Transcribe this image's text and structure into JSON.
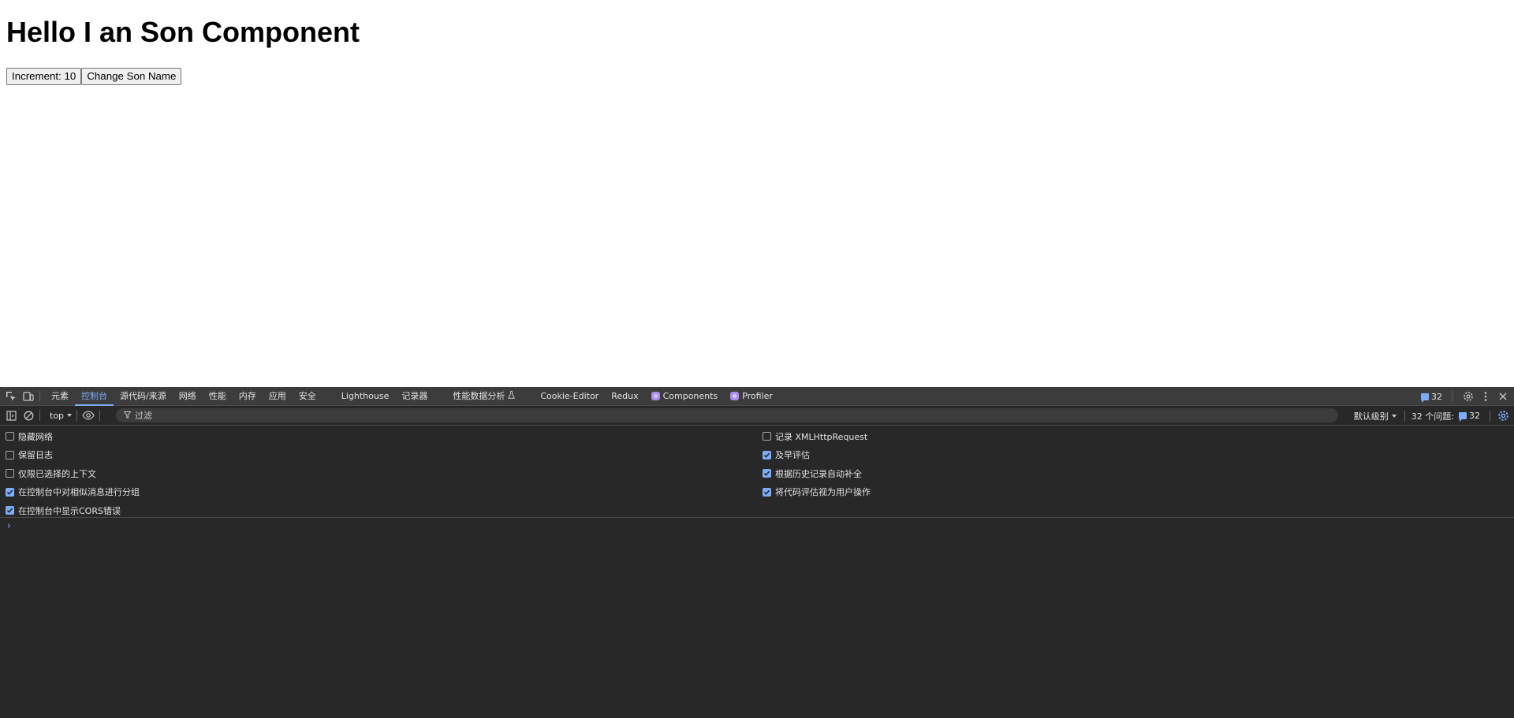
{
  "page": {
    "heading": "Hello I an Son Component",
    "buttons": {
      "increment_label": "Increment: 10",
      "change_name_label": "Change Son Name"
    }
  },
  "devtools": {
    "tabs": [
      {
        "label": "元素",
        "active": false
      },
      {
        "label": "控制台",
        "active": true
      },
      {
        "label": "源代码/来源",
        "active": false
      },
      {
        "label": "网络",
        "active": false
      },
      {
        "label": "性能",
        "active": false
      },
      {
        "label": "内存",
        "active": false
      },
      {
        "label": "应用",
        "active": false
      },
      {
        "label": "安全",
        "active": false
      },
      {
        "label": "Lighthouse",
        "active": false
      },
      {
        "label": "记录器",
        "active": false
      },
      {
        "label": "性能数据分析",
        "active": false
      },
      {
        "label": "Cookie-Editor",
        "active": false
      },
      {
        "label": "Redux",
        "active": false
      },
      {
        "label": "Components",
        "active": false
      },
      {
        "label": "Profiler",
        "active": false
      }
    ],
    "issues_badge_count": "32",
    "toolbar": {
      "context": "top",
      "filter_placeholder": "过滤",
      "level": "默认级别",
      "issues_label": "32 个问题:",
      "issues_count": "32"
    },
    "settings": {
      "left": [
        {
          "label": "隐藏网络",
          "checked": false
        },
        {
          "label": "保留日志",
          "checked": false
        },
        {
          "label": "仅限已选择的上下文",
          "checked": false
        },
        {
          "label": "在控制台中对相似消息进行分组",
          "checked": true
        },
        {
          "label": "在控制台中显示CORS错误",
          "checked": true
        }
      ],
      "right": [
        {
          "label": "记录 XMLHttpRequest",
          "checked": false
        },
        {
          "label": "及早评估",
          "checked": true
        },
        {
          "label": "根据历史记录自动补全",
          "checked": true
        },
        {
          "label": "将代码评估视为用户操作",
          "checked": true
        }
      ]
    },
    "prompt_symbol": "›",
    "colors": {
      "panel_bg": "#282828",
      "tabbar_bg": "#3c3c3c",
      "accent": "#7cacf8",
      "text": "#e3e3e3"
    }
  }
}
